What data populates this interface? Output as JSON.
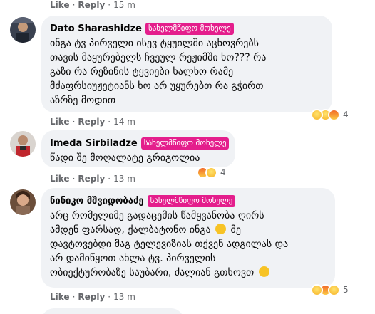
{
  "comments": [
    {
      "actions": {
        "like": "Like",
        "reply": "Reply",
        "time": "15 m"
      }
    },
    {
      "author": "Dato Sharashidze",
      "badge": "სახელმწიფო მოხელე",
      "lines": [
        "ინგა ტვ პირველი ისევ ტყუილში აცხოვრებს",
        "თავის მაყურებელს ჩვეულ რეჟიმში ხო??? რა",
        "გაზი რა რეზინის ტყვიები ხალხო რამე",
        "მძაფრსიუჟეტიანს ხო არ უყურებთ რა გჭირთ",
        "აზრზე მოდით"
      ],
      "reactions": {
        "icons": [
          "haha",
          "sad",
          "angry"
        ],
        "count": "4"
      },
      "actions": {
        "like": "Like",
        "reply": "Reply",
        "time": "14 m"
      }
    },
    {
      "author": "Imeda Sirbiladze",
      "badge": "სახელმწიფო მოხელე",
      "lines": [
        "წადი შე მოღალატე გრიგოლია"
      ],
      "reactions": {
        "icons": [
          "angry",
          "haha"
        ],
        "count": "4"
      },
      "actions": {
        "like": "Like",
        "reply": "Reply",
        "time": "13 m"
      }
    },
    {
      "author": "ნინიკო მშვიდობაძე",
      "badge": "სახელმწიფო მოხელე",
      "lines": [
        "არც რომელიმე გადაცემის წამყვანობა ღირს",
        "ამდენ ფარსად, ქალბატონო ინგა",
        " მე",
        "დავტოვებდი მაგ ტელევიზიას თქვენ ადგილას და",
        "არ დამიწყოთ ახლა ტვ. პირველის",
        "ობიექტურობაზე საუბარი, ძალიან გთხოვთ"
      ],
      "reactions": {
        "icons": [
          "haha",
          "angry",
          "sad"
        ],
        "count": "5"
      },
      "actions": {
        "like": "Like",
        "reply": "Reply",
        "time": "13 m"
      }
    }
  ]
}
